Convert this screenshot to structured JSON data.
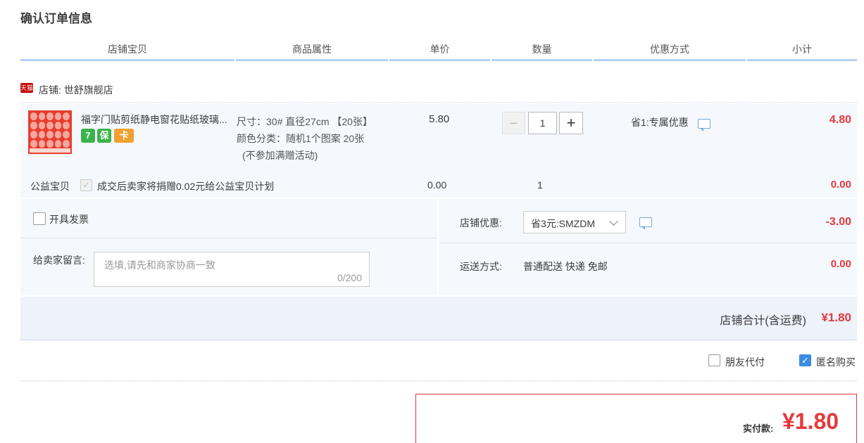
{
  "page": {
    "title": "确认订单信息"
  },
  "table_headers": [
    "店铺宝贝",
    "商品属性",
    "单价",
    "数量",
    "优惠方式",
    "小计"
  ],
  "store": {
    "badge": "天猫",
    "name": "店铺: 世舒旗舰店"
  },
  "item": {
    "title": "福字门贴剪纸静电窗花贴纸玻璃...",
    "service_badges": [
      {
        "text": "7",
        "color": "#3bb34a",
        "icon": "seven-day-return-icon"
      },
      {
        "text": "保",
        "color": "#3bb34a",
        "icon": "guarantee-icon"
      },
      {
        "text": "卡",
        "color": "#f0a030",
        "icon": "credit-card-icon"
      }
    ],
    "attr_size": "尺寸：30# 直径27cm 【20张】",
    "attr_color": "颜色分类：随机1个图案 20张",
    "attr_note": "(不参加满赠活动)",
    "price": "5.80",
    "qty": "1",
    "qty_minus": "−",
    "qty_plus": "+",
    "discount": "省1:专属优惠",
    "subtotal": "4.80"
  },
  "charity": {
    "label": "公益宝贝",
    "text": "成交后卖家将捐赠0.02元给公益宝贝计划",
    "price": "0.00",
    "qty": "1",
    "subtotal": "0.00"
  },
  "invoice": {
    "label": "开具发票",
    "checked": false
  },
  "message": {
    "label": "给卖家留言:",
    "placeholder": "选填,请先和商家协商一致",
    "count": "0/200"
  },
  "coupon": {
    "label": "店铺优惠:",
    "value": "省3元:SMZDM",
    "amount": "-3.00"
  },
  "shipping": {
    "label": "运送方式:",
    "value": "普通配送 快递 免邮",
    "amount": "0.00"
  },
  "store_total": {
    "label": "店铺合计(含运费)",
    "value": "¥1.80"
  },
  "options": {
    "friend_pay": {
      "label": "朋友代付",
      "checked": false
    },
    "anonymous": {
      "label": "匿名购买",
      "checked": true
    }
  },
  "payment": {
    "label": "实付款:",
    "value": "¥1.80"
  },
  "colors": {
    "accent_red": "#e4393c",
    "header_blue": "#b2d1f4",
    "panel_bg": "#f5f8fd"
  }
}
